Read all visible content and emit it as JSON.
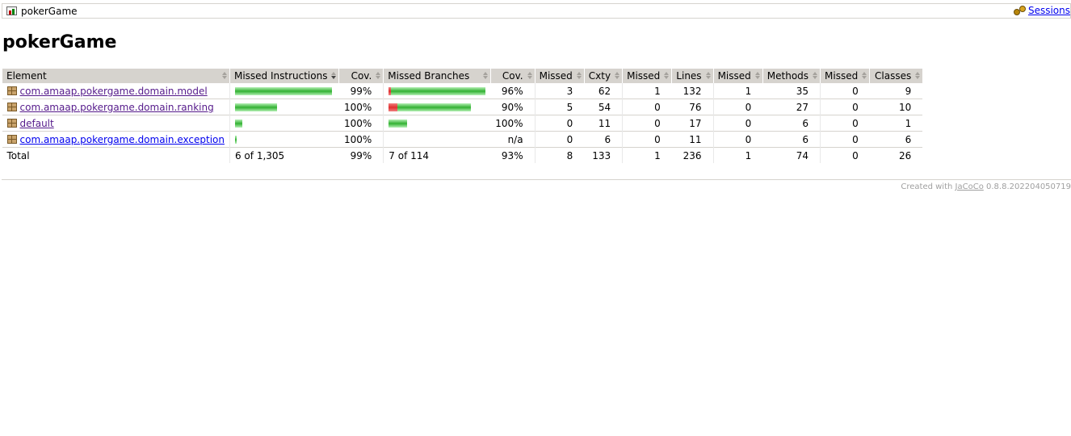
{
  "breadcrumb": {
    "title": "pokerGame",
    "sessions_link": "Sessions"
  },
  "page_title": "pokerGame",
  "table": {
    "headers": [
      "Element",
      "Missed Instructions",
      "Cov.",
      "Missed Branches",
      "Cov.",
      "Missed",
      "Cxty",
      "Missed",
      "Lines",
      "Missed",
      "Methods",
      "Missed",
      "Classes"
    ],
    "rows": [
      {
        "name": "com.amaap.pokergame.domain.model",
        "instr_bar": {
          "missed": 0,
          "covered": 1
        },
        "instr_cov": "99%",
        "branch_bar": {
          "missed": 0.025,
          "covered": 0.975
        },
        "branch_cov": "96%",
        "cxty_missed": "3",
        "cxty": "62",
        "lines_missed": "1",
        "lines": "132",
        "methods_missed": "1",
        "methods": "35",
        "classes_missed": "0",
        "classes": "9"
      },
      {
        "name": "com.amaap.pokergame.domain.ranking",
        "instr_bar": {
          "missed": 0,
          "covered": 0.435
        },
        "instr_cov": "100%",
        "branch_bar": {
          "missed": 0.09,
          "covered": 0.76
        },
        "branch_cov": "90%",
        "cxty_missed": "5",
        "cxty": "54",
        "lines_missed": "0",
        "lines": "76",
        "methods_missed": "0",
        "methods": "27",
        "classes_missed": "0",
        "classes": "10"
      },
      {
        "name": "default",
        "instr_bar": {
          "missed": 0,
          "covered": 0.075
        },
        "instr_cov": "100%",
        "branch_bar": {
          "missed": 0,
          "covered": 0.19
        },
        "branch_cov": "100%",
        "cxty_missed": "0",
        "cxty": "11",
        "lines_missed": "0",
        "lines": "17",
        "methods_missed": "0",
        "methods": "6",
        "classes_missed": "0",
        "classes": "1"
      },
      {
        "name": "com.amaap.pokergame.domain.exception",
        "instr_bar": {
          "missed": 0,
          "covered": 0.02
        },
        "instr_cov": "100%",
        "branch_bar": null,
        "branch_cov": "n/a",
        "cxty_missed": "0",
        "cxty": "6",
        "lines_missed": "0",
        "lines": "11",
        "methods_missed": "0",
        "methods": "6",
        "classes_missed": "0",
        "classes": "6"
      }
    ],
    "total": {
      "label": "Total",
      "instr": "6 of 1,305",
      "instr_cov": "99%",
      "branch": "7 of 114",
      "branch_cov": "93%",
      "cxty_missed": "8",
      "cxty": "133",
      "lines_missed": "1",
      "lines": "236",
      "methods_missed": "1",
      "methods": "74",
      "classes_missed": "0",
      "classes": "26"
    }
  },
  "footer": {
    "prefix": "Created with",
    "link": "JaCoCo",
    "version": "0.8.8.202204050719"
  },
  "colors": {
    "header_bg": "#d6d3ce",
    "bar_green": "#32b132",
    "bar_red": "#e03030"
  }
}
